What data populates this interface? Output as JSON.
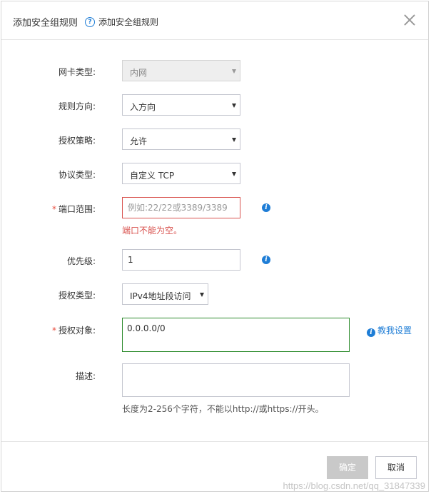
{
  "dialog": {
    "title": "添加安全组规则",
    "help_icon": "?",
    "help_link": "添加安全组规则",
    "close_icon": "close-icon"
  },
  "form": {
    "nic_type": {
      "label": "网卡类型:",
      "value": "内网"
    },
    "direction": {
      "label": "规则方向:",
      "value": "入方向"
    },
    "policy": {
      "label": "授权策略:",
      "value": "允许"
    },
    "protocol": {
      "label": "协议类型:",
      "value": "自定义 TCP"
    },
    "port_range": {
      "required": "*",
      "label": "端口范围:",
      "value": "",
      "placeholder": "例如:22/22或3389/3389",
      "error": "端口不能为空。",
      "info_icon": "i"
    },
    "priority": {
      "label": "优先级:",
      "value": "1",
      "info_icon": "i"
    },
    "auth_type": {
      "label": "授权类型:",
      "value": "IPv4地址段访问"
    },
    "auth_object": {
      "required": "*",
      "label": "授权对象:",
      "value": "0.0.0.0/0",
      "link_icon": "i",
      "link": "教我设置"
    },
    "description": {
      "label": "描述:",
      "value": "",
      "hint": "长度为2-256个字符，不能以http://或https://开头。"
    }
  },
  "footer": {
    "ok_label": "确定",
    "cancel_label": "取消"
  },
  "watermark": "https://blog.csdn.net/qq_31847339",
  "colors": {
    "accent": "#1e7dd6",
    "error": "#d9534f",
    "success": "#2c8a2c",
    "disabled_button": "#c9c9c9"
  }
}
